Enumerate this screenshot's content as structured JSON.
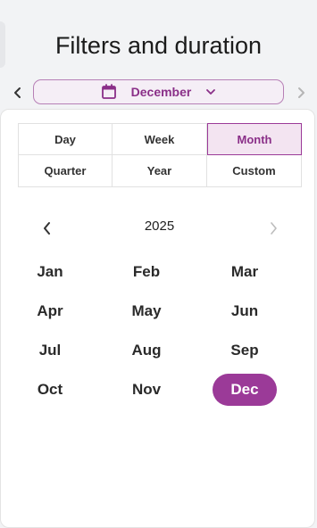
{
  "header": {
    "title": "Filters and duration"
  },
  "period_nav": {
    "selected_label": "December",
    "prev_icon": "chevron-left-icon",
    "next_icon": "chevron-right-icon",
    "calendar_icon": "calendar-icon",
    "dropdown_icon": "chevron-down-icon"
  },
  "granularity_tabs": [
    {
      "label": "Day",
      "selected": false
    },
    {
      "label": "Week",
      "selected": false
    },
    {
      "label": "Month",
      "selected": true
    },
    {
      "label": "Quarter",
      "selected": false
    },
    {
      "label": "Year",
      "selected": false
    },
    {
      "label": "Custom",
      "selected": false
    }
  ],
  "year_picker": {
    "year": "2025"
  },
  "months": [
    {
      "label": "Jan",
      "selected": false
    },
    {
      "label": "Feb",
      "selected": false
    },
    {
      "label": "Mar",
      "selected": false
    },
    {
      "label": "Apr",
      "selected": false
    },
    {
      "label": "May",
      "selected": false
    },
    {
      "label": "Jun",
      "selected": false
    },
    {
      "label": "Jul",
      "selected": false
    },
    {
      "label": "Aug",
      "selected": false
    },
    {
      "label": "Sep",
      "selected": false
    },
    {
      "label": "Oct",
      "selected": false
    },
    {
      "label": "Nov",
      "selected": false
    },
    {
      "label": "Dec",
      "selected": true
    }
  ],
  "colors": {
    "accent": "#9b3a98",
    "accent_text": "#8a2f88",
    "accent_light": "#f3e4f1"
  }
}
